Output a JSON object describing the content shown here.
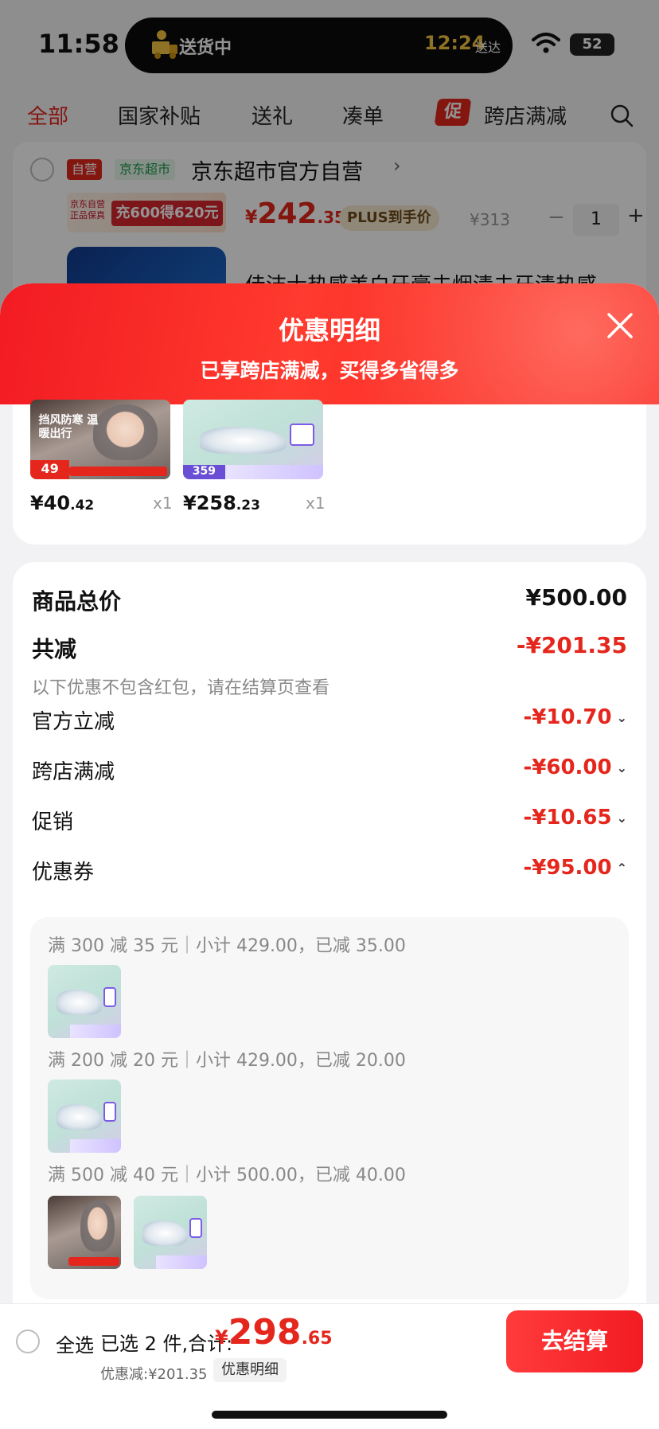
{
  "status_bar": {
    "time": "11:58",
    "island_label": "送货中",
    "island_time": "12:24",
    "island_arrive": "送达",
    "battery": "52"
  },
  "filter_tabs": [
    {
      "label": "全部",
      "active": true
    },
    {
      "label": "国家补贴"
    },
    {
      "label": "送礼"
    },
    {
      "label": "凑单"
    },
    {
      "label": "跨店满减",
      "tag": "促"
    }
  ],
  "store": {
    "badge_self": "自营",
    "badge_market": "京东超市",
    "name": "京东超市官方自营",
    "promo_left": "京东自营 正品保真",
    "promo_right": "充600得620元",
    "price_yen": "¥",
    "price_int": "242",
    "price_dec": ".35",
    "plus_label": "PLUS到手价",
    "price_old": "¥313",
    "qty": "1",
    "qty_minus": "−",
    "qty_plus": "+",
    "product_title": "佳洁士热感美白牙膏去烟渍去牙渍热感"
  },
  "sheet": {
    "title": "优惠明细",
    "subtitle": "已享跨店满减，买得多省得多"
  },
  "top_products": [
    {
      "price_int": "¥40",
      "price_dec": ".42",
      "qty": "x1",
      "img_text": "挡风防寒 温暖出行",
      "img_price": "49"
    },
    {
      "price_int": "¥258",
      "price_dec": ".23",
      "qty": "x1",
      "img_price": "359"
    }
  ],
  "summary": {
    "total_label": "商品总价",
    "total_value": "¥500.00",
    "reduce_label": "共减",
    "reduce_value": "-¥201.35",
    "note": "以下优惠不包含红包，请在结算页查看",
    "rows": [
      {
        "label": "官方立减",
        "value": "-¥10.70",
        "chev": "⌄"
      },
      {
        "label": "跨店满减",
        "value": "-¥60.00",
        "chev": "⌄"
      },
      {
        "label": "促销",
        "value": "-¥10.65",
        "chev": "⌄"
      },
      {
        "label": "优惠券",
        "value": "-¥95.00",
        "chev": "⌃"
      }
    ]
  },
  "coupons": [
    {
      "rule": "满 300 减 35 元｜小计 429.00，已减 35.00"
    },
    {
      "rule": "满 200 减 20 元｜小计 429.00，已减 20.00"
    },
    {
      "rule": "满 500 减 40 元｜小计 500.00，已减 40.00"
    }
  ],
  "bottom_bar": {
    "select_all": "全选",
    "selected_text": "已选 2 件,合计:",
    "total_yen": "¥",
    "total_int": "298",
    "total_dec": ".65",
    "discount_text": "优惠减:¥201.35",
    "detail_button": "优惠明细",
    "checkout_button": "去结算"
  },
  "colors": {
    "accent_red": "#e4261c",
    "header_red": "#f21b22"
  }
}
